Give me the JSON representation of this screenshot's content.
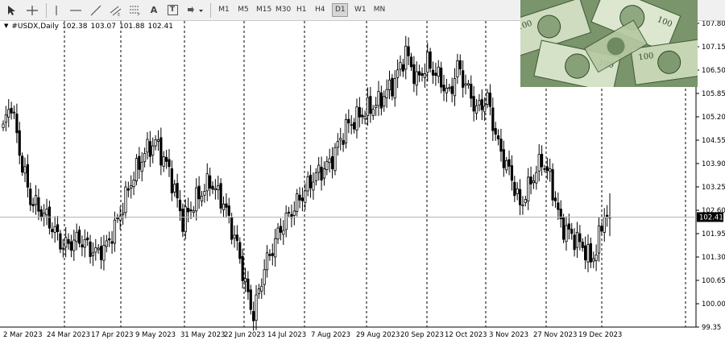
{
  "toolbar": {
    "tools": [
      {
        "name": "cursor-tool",
        "icon": "cursor-icon"
      },
      {
        "name": "crosshair-tool",
        "icon": "crosshair-icon"
      },
      {
        "name": "vertical-line-tool",
        "icon": "vertical-line-icon"
      },
      {
        "name": "horizontal-line-tool",
        "icon": "horizontal-line-icon"
      },
      {
        "name": "trendline-tool",
        "icon": "trendline-icon"
      },
      {
        "name": "equidistant-channel-tool",
        "icon": "channel-icon"
      },
      {
        "name": "fibonacci-tool",
        "icon": "fibonacci-icon"
      },
      {
        "name": "text-tool",
        "icon": "text-icon"
      },
      {
        "name": "text-label-tool",
        "icon": "text-label-icon"
      },
      {
        "name": "arrows-tool",
        "icon": "arrows-dropdown-icon"
      }
    ],
    "text_tool_glyph": "A",
    "label_tool_glyph": "T",
    "timeframes": [
      "M1",
      "M5",
      "M15",
      "M30",
      "H1",
      "H4",
      "D1",
      "W1",
      "MN"
    ],
    "active_timeframe": "D1"
  },
  "chart": {
    "symbol": "#USDX,Daily",
    "open": "102.38",
    "high": "103.07",
    "low": "101.88",
    "close": "102.41",
    "current_price": "102.41",
    "colors": {
      "candle": "#000000",
      "background": "#ffffff",
      "price_tag": "#000000"
    }
  },
  "chart_data": {
    "type": "candlestick",
    "title": "#USDX,Daily",
    "ohlc_header": {
      "open": 102.38,
      "high": 103.07,
      "low": 101.88,
      "close": 102.41
    },
    "ylim": [
      99.35,
      108.0
    ],
    "y_ticks": [
      "107.80",
      "107.15",
      "106.50",
      "105.85",
      "105.20",
      "104.55",
      "103.90",
      "103.25",
      "102.60",
      "101.95",
      "101.30",
      "100.65",
      "100.00",
      "99.35"
    ],
    "x_ticks": [
      "2 Mar 2023",
      "24 Mar 2023",
      "17 Apr 2023",
      "9 May 2023",
      "31 May 2023",
      "22 Jun 2023",
      "14 Jul 2023",
      "7 Aug 2023",
      "29 Aug 2023",
      "20 Sep 2023",
      "12 Oct 2023",
      "3 Nov 2023",
      "27 Nov 2023",
      "19 Dec 2023"
    ],
    "grid": "vertical dashed lines at x ticks",
    "last_price": 102.41,
    "close_path_anchors": [
      [
        0,
        104.9
      ],
      [
        3,
        105.6
      ],
      [
        6,
        104.2
      ],
      [
        10,
        102.9
      ],
      [
        16,
        102.4
      ],
      [
        22,
        101.6
      ],
      [
        28,
        101.8
      ],
      [
        34,
        101.4
      ],
      [
        38,
        101.6
      ],
      [
        42,
        102.3
      ],
      [
        47,
        103.4
      ],
      [
        52,
        104.2
      ],
      [
        56,
        104.5
      ],
      [
        61,
        103.7
      ],
      [
        66,
        102.3
      ],
      [
        71,
        102.9
      ],
      [
        76,
        103.4
      ],
      [
        81,
        102.8
      ],
      [
        86,
        101.6
      ],
      [
        90,
        100.2
      ],
      [
        92,
        99.7
      ],
      [
        96,
        101.0
      ],
      [
        102,
        102.1
      ],
      [
        108,
        102.8
      ],
      [
        114,
        103.5
      ],
      [
        120,
        103.9
      ],
      [
        126,
        104.9
      ],
      [
        132,
        105.3
      ],
      [
        138,
        105.6
      ],
      [
        144,
        106.2
      ],
      [
        148,
        107.0
      ],
      [
        152,
        106.2
      ],
      [
        156,
        106.7
      ],
      [
        160,
        106.3
      ],
      [
        164,
        105.8
      ],
      [
        167,
        106.6
      ],
      [
        170,
        106.1
      ],
      [
        174,
        105.4
      ],
      [
        178,
        105.7
      ],
      [
        182,
        104.4
      ],
      [
        187,
        103.5
      ],
      [
        190,
        102.7
      ],
      [
        194,
        103.4
      ],
      [
        198,
        104.0
      ],
      [
        201,
        103.5
      ],
      [
        205,
        102.2
      ],
      [
        209,
        101.9
      ],
      [
        213,
        101.6
      ],
      [
        216,
        101.2
      ],
      [
        218,
        101.5
      ],
      [
        221,
        102.5
      ],
      [
        223,
        102.4
      ]
    ]
  }
}
